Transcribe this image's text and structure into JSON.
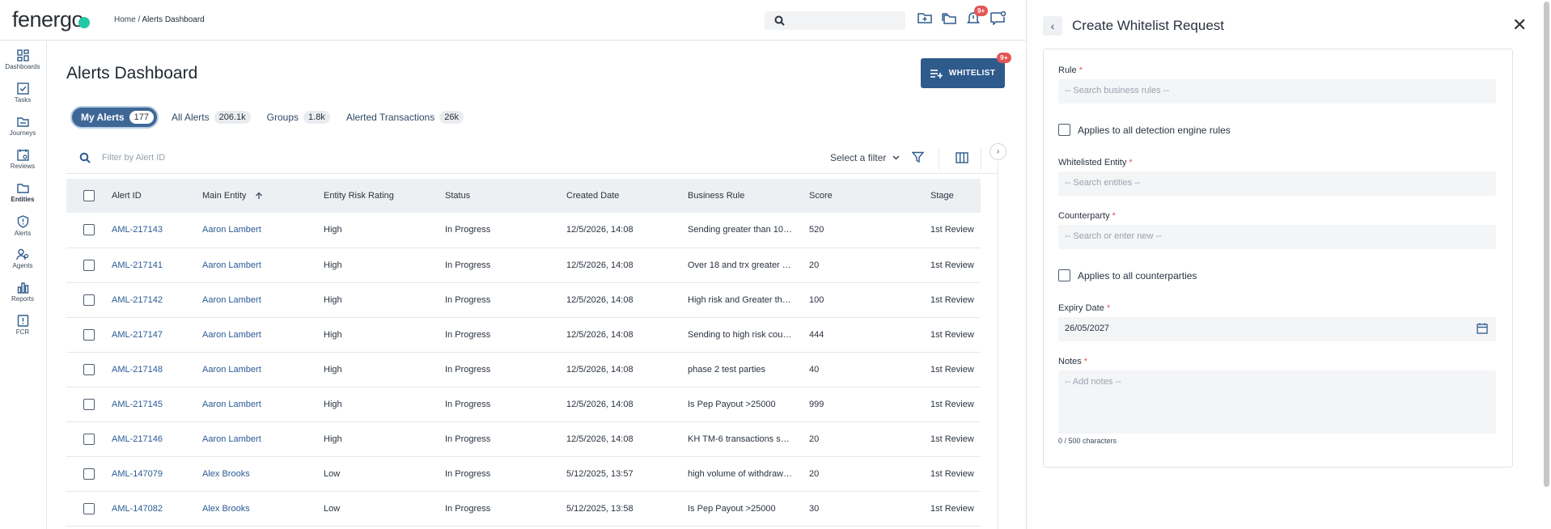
{
  "header": {
    "logo_text": "fenergo",
    "breadcrumb_home": "Home",
    "breadcrumb_sep": " / ",
    "breadcrumb_current": "Alerts Dashboard",
    "notification_badge": "9+"
  },
  "sidenav": [
    {
      "label": "Dashboards",
      "icon": "dashboards-icon"
    },
    {
      "label": "Tasks",
      "icon": "tasks-icon"
    },
    {
      "label": "Journeys",
      "icon": "journeys-icon"
    },
    {
      "label": "Reviews",
      "icon": "reviews-icon"
    },
    {
      "label": "Entities",
      "icon": "entities-icon"
    },
    {
      "label": "Alerts",
      "icon": "alerts-icon"
    },
    {
      "label": "Agents",
      "icon": "agents-icon"
    },
    {
      "label": "Reports",
      "icon": "reports-icon"
    },
    {
      "label": "FCR",
      "icon": "fcr-icon"
    }
  ],
  "main": {
    "title": "Alerts Dashboard",
    "whitelist_button": "WHITELIST",
    "whitelist_badge": "9+",
    "tabs": [
      {
        "label": "My Alerts",
        "count": "177",
        "active": true
      },
      {
        "label": "All Alerts",
        "count": "206.1k"
      },
      {
        "label": "Groups",
        "count": "1.8k"
      },
      {
        "label": "Alerted Transactions",
        "count": "26k"
      }
    ],
    "filter_placeholder": "Filter by Alert ID",
    "select_filter": "Select a filter",
    "columns": [
      "Alert ID",
      "Main Entity",
      "Entity Risk Rating",
      "Status",
      "Created Date",
      "Business Rule",
      "Score",
      "Stage"
    ],
    "rows": [
      {
        "id": "AML-217143",
        "entity": "Aaron Lambert",
        "risk": "High",
        "status": "In Progress",
        "created": "12/5/2026, 14:08",
        "rule": "Sending greater than 100,...",
        "score": "520",
        "stage": "1st Review"
      },
      {
        "id": "AML-217141",
        "entity": "Aaron Lambert",
        "risk": "High",
        "status": "In Progress",
        "created": "12/5/2026, 14:08",
        "rule": "Over 18 and trx greater th...",
        "score": "20",
        "stage": "1st Review"
      },
      {
        "id": "AML-217142",
        "entity": "Aaron Lambert",
        "risk": "High",
        "status": "In Progress",
        "created": "12/5/2026, 14:08",
        "rule": "High risk and Greater than...",
        "score": "100",
        "stage": "1st Review"
      },
      {
        "id": "AML-217147",
        "entity": "Aaron Lambert",
        "risk": "High",
        "status": "In Progress",
        "created": "12/5/2026, 14:08",
        "rule": "Sending to high risk country",
        "score": "444",
        "stage": "1st Review"
      },
      {
        "id": "AML-217148",
        "entity": "Aaron Lambert",
        "risk": "High",
        "status": "In Progress",
        "created": "12/5/2026, 14:08",
        "rule": "phase 2 test parties",
        "score": "40",
        "stage": "1st Review"
      },
      {
        "id": "AML-217145",
        "entity": "Aaron Lambert",
        "risk": "High",
        "status": "In Progress",
        "created": "12/5/2026, 14:08",
        "rule": "Is Pep Payout >25000",
        "score": "999",
        "stage": "1st Review"
      },
      {
        "id": "AML-217146",
        "entity": "Aaron Lambert",
        "risk": "High",
        "status": "In Progress",
        "created": "12/5/2026, 14:08",
        "rule": "KH TM-6 transactions sen...",
        "score": "20",
        "stage": "1st Review"
      },
      {
        "id": "AML-147079",
        "entity": "Alex Brooks",
        "risk": "Low",
        "status": "In Progress",
        "created": "5/12/2025, 13:57",
        "rule": "high volume of withdrawal...",
        "score": "20",
        "stage": "1st Review"
      },
      {
        "id": "AML-147082",
        "entity": "Alex Brooks",
        "risk": "Low",
        "status": "In Progress",
        "created": "5/12/2025, 13:58",
        "rule": "Is Pep Payout >25000",
        "score": "30",
        "stage": "1st Review"
      }
    ]
  },
  "drawer": {
    "title": "Create Whitelist Request",
    "rule_label": "Rule",
    "rule_placeholder": "-- Search business rules --",
    "all_rules_label": "Applies to all detection engine rules",
    "entity_label": "Whitelisted Entity",
    "entity_placeholder": "-- Search entities --",
    "counterparty_label": "Counterparty",
    "counterparty_placeholder": "-- Search or enter new --",
    "all_counterparties_label": "Applies to all counterparties",
    "expiry_label": "Expiry Date",
    "expiry_value": "26/05/2027",
    "notes_label": "Notes",
    "notes_placeholder": "-- Add notes --",
    "char_count": "0 / 500 characters",
    "required_mark": "*"
  },
  "colors": {
    "primary": "#2e5a8c",
    "active_tab": "#3e6796",
    "link": "#2a5a96",
    "badge": "#e35656",
    "logo_dot": "#22c9a8"
  }
}
